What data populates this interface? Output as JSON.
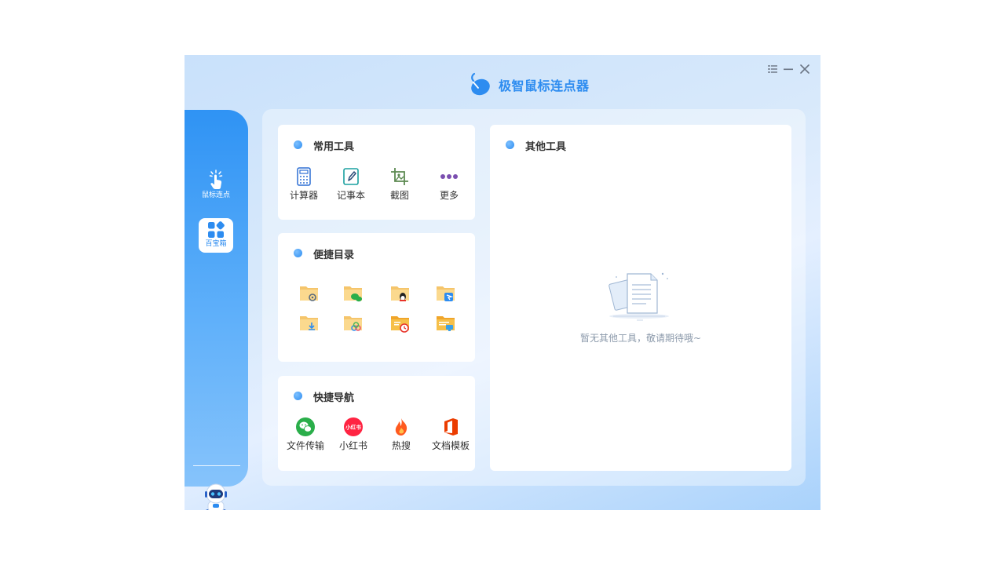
{
  "app": {
    "title": "极智鼠标连点器"
  },
  "sidebar": {
    "items": [
      {
        "label": "鼠标连点"
      },
      {
        "label": "百宝箱"
      }
    ]
  },
  "common_tools": {
    "title": "常用工具",
    "items": [
      {
        "label": "计算器",
        "icon": "calculator-icon"
      },
      {
        "label": "记事本",
        "icon": "notepad-icon"
      },
      {
        "label": "截图",
        "icon": "crop-icon"
      },
      {
        "label": "更多",
        "icon": "more-icon"
      }
    ]
  },
  "quick_dirs": {
    "title": "便捷目录",
    "folders": [
      "gear-folder-icon",
      "wechat-folder-icon",
      "qq-folder-icon",
      "dingtalk-folder-icon",
      "download-folder-icon",
      "cloud-folder-icon",
      "recent-folder-icon",
      "desktop-folder-icon"
    ]
  },
  "quick_nav": {
    "title": "快捷导航",
    "items": [
      {
        "label": "文件传输",
        "icon": "wechat-icon"
      },
      {
        "label": "小红书",
        "icon": "xiaohongshu-icon",
        "badge": "小红书"
      },
      {
        "label": "热搜",
        "icon": "fire-icon"
      },
      {
        "label": "文档模板",
        "icon": "office-icon"
      }
    ]
  },
  "other_tools": {
    "title": "其他工具",
    "empty_text": "暂无其他工具，敬请期待哦~"
  },
  "colors": {
    "accent": "#2d8cf0",
    "sidebar": "#2f93f4"
  }
}
